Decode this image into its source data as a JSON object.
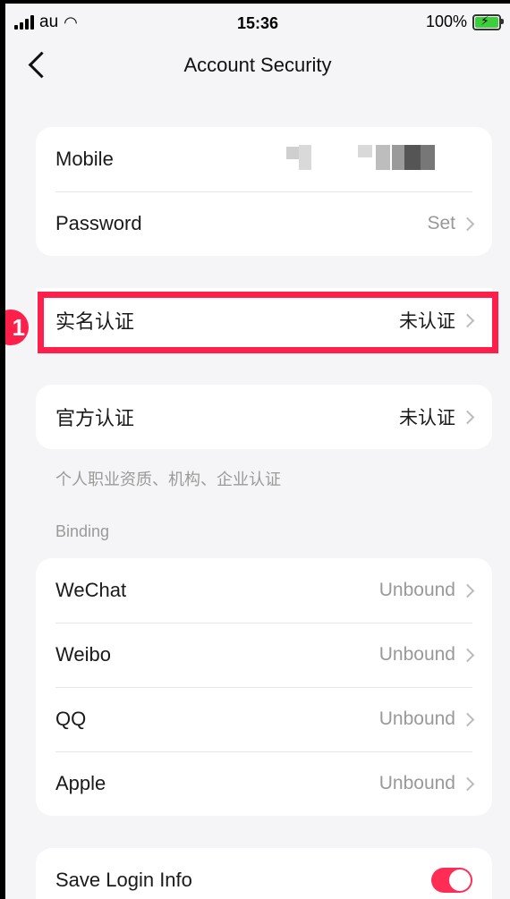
{
  "status_bar": {
    "carrier": "au",
    "time": "15:36",
    "battery": "100%"
  },
  "nav": {
    "title": "Account Security"
  },
  "account": {
    "mobile_label": "Mobile",
    "password_label": "Password",
    "password_value": "Set"
  },
  "realname": {
    "label": "实名认证",
    "value": "未认证"
  },
  "official": {
    "label": "官方认证",
    "value": "未认证",
    "note": "个人职业资质、机构、企业认证"
  },
  "binding": {
    "header": "Binding",
    "items": [
      {
        "label": "WeChat",
        "value": "Unbound"
      },
      {
        "label": "Weibo",
        "value": "Unbound"
      },
      {
        "label": "QQ",
        "value": "Unbound"
      },
      {
        "label": "Apple",
        "value": "Unbound"
      }
    ]
  },
  "save_login": {
    "label": "Save Login Info",
    "enabled": true
  },
  "annotation": {
    "step": "1"
  },
  "colors": {
    "accent": "#ff2d55",
    "highlight": "#ff1f4b",
    "background": "#f5f5f7"
  }
}
